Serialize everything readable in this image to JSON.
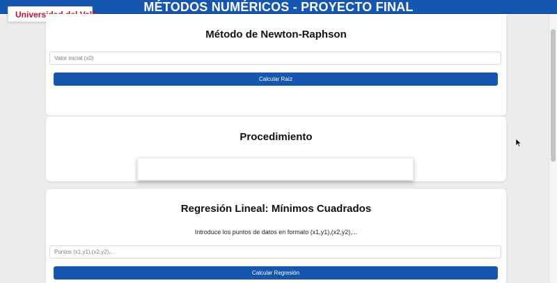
{
  "header": {
    "title": "MÉTODOS NUMÉRICOS - PROYECTO FINAL",
    "logo_text": "Universidad del Valle",
    "logo_icon": "univalle-logo-icon"
  },
  "newton": {
    "title": "Método de Newton-Raphson",
    "input_placeholder": "Valor inicial (x0)",
    "input_value": "",
    "button_label": "Calcular Raíz"
  },
  "procedure": {
    "title": "Procedimiento",
    "content": ""
  },
  "regression": {
    "title": "Regresión Lineal: Mínimos Cuadrados",
    "instruction": "Introduce los puntos de datos en formato (x1,y1),(x2,y2),...",
    "input_placeholder": "Puntos (x1,y1),(x2,y2),...",
    "input_value": "",
    "button_label": "Calcular Regresión"
  },
  "colors": {
    "accent": "#1556b1",
    "logo_red": "#c8102e",
    "background": "#ececec"
  },
  "icons": [
    "univalle-logo-icon",
    "mouse-pointer-icon"
  ]
}
